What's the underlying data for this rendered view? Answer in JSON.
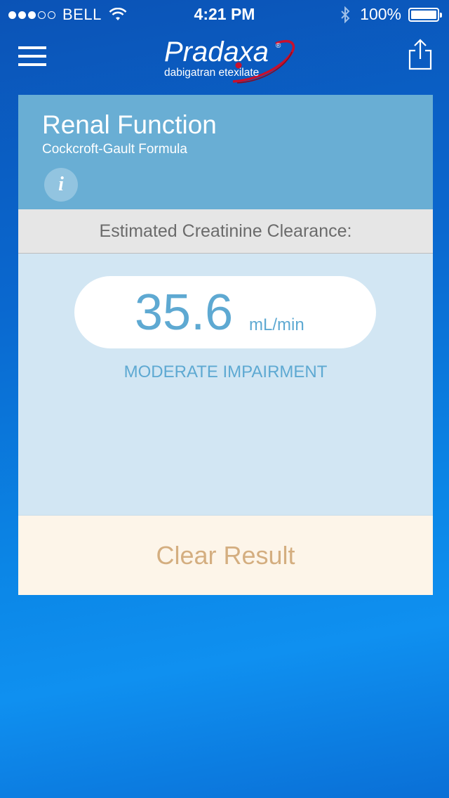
{
  "status_bar": {
    "carrier": "BELL",
    "signal_bars_filled": 3,
    "signal_bars_total": 5,
    "time": "4:21 PM",
    "battery": "100%",
    "wifi_icon": "wifi-icon",
    "bluetooth_icon": "bluetooth-icon"
  },
  "nav": {
    "menu_icon": "hamburger-menu-icon",
    "share_icon": "share-icon",
    "logo": {
      "brand": "Pradaxa",
      "registered": "®",
      "generic": "dabigatran etexilate"
    }
  },
  "calculator": {
    "title": "Renal Function",
    "subtitle": "Cockcroft-Gault Formula",
    "info_label": "i",
    "result_label": "Estimated Creatinine Clearance:",
    "result_value": "35.6",
    "result_unit": "mL/min",
    "result_category": "MODERATE IMPAIRMENT",
    "clear_button": "Clear Result"
  },
  "colors": {
    "background": "#0a6fd6",
    "header": "#69aed4",
    "result_area": "#d2e6f3",
    "accent": "#5ea9d2",
    "clear_button_bg": "#fdf5e9",
    "clear_button_text": "#d4ae80",
    "logo_swoosh": "#c8102e"
  }
}
